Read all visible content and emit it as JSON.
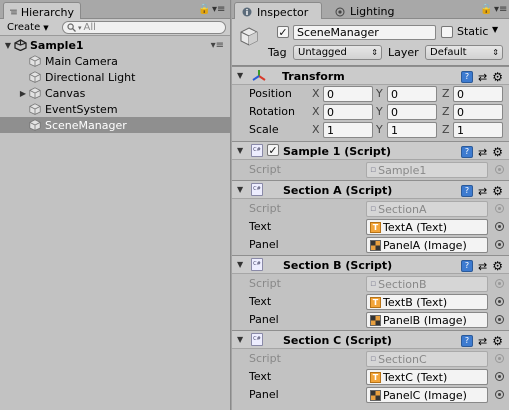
{
  "hierarchy": {
    "tab_label": "Hierarchy",
    "create_label": "Create",
    "search_placeholder": "All",
    "scene_name": "Sample1",
    "items": [
      {
        "label": "Main Camera",
        "expandable": false,
        "selected": false
      },
      {
        "label": "Directional Light",
        "expandable": false,
        "selected": false
      },
      {
        "label": "Canvas",
        "expandable": true,
        "selected": false
      },
      {
        "label": "EventSystem",
        "expandable": false,
        "selected": false
      },
      {
        "label": "SceneManager",
        "expandable": false,
        "selected": true
      }
    ]
  },
  "inspector": {
    "tab_label": "Inspector",
    "lighting_tab_label": "Lighting",
    "gameobject": {
      "active": true,
      "name": "SceneManager",
      "static_label": "Static",
      "tag_label": "Tag",
      "tag_value": "Untagged",
      "layer_label": "Layer",
      "layer_value": "Default"
    },
    "transform": {
      "title": "Transform",
      "rows": [
        {
          "label": "Position",
          "x": "0",
          "y": "0",
          "z": "0"
        },
        {
          "label": "Rotation",
          "x": "0",
          "y": "0",
          "z": "0"
        },
        {
          "label": "Scale",
          "x": "1",
          "y": "1",
          "z": "1"
        }
      ],
      "axis_x": "X",
      "axis_y": "Y",
      "axis_z": "Z"
    },
    "components": [
      {
        "title": "Sample 1 (Script)",
        "checkbox": true,
        "script_label": "Script",
        "script_value": "Sample1",
        "props": []
      },
      {
        "title": "Section A (Script)",
        "checkbox": false,
        "script_label": "Script",
        "script_value": "SectionA",
        "props": [
          {
            "label": "Text",
            "value": "TextA (Text)",
            "kind": "text"
          },
          {
            "label": "Panel",
            "value": "PanelA (Image)",
            "kind": "image"
          }
        ]
      },
      {
        "title": "Section B (Script)",
        "checkbox": false,
        "script_label": "Script",
        "script_value": "SectionB",
        "props": [
          {
            "label": "Text",
            "value": "TextB (Text)",
            "kind": "text"
          },
          {
            "label": "Panel",
            "value": "PanelB (Image)",
            "kind": "image"
          }
        ]
      },
      {
        "title": "Section C (Script)",
        "checkbox": false,
        "script_label": "Script",
        "script_value": "SectionC",
        "props": [
          {
            "label": "Text",
            "value": "TextC (Text)",
            "kind": "text"
          },
          {
            "label": "Panel",
            "value": "PanelC (Image)",
            "kind": "image"
          }
        ]
      }
    ]
  }
}
